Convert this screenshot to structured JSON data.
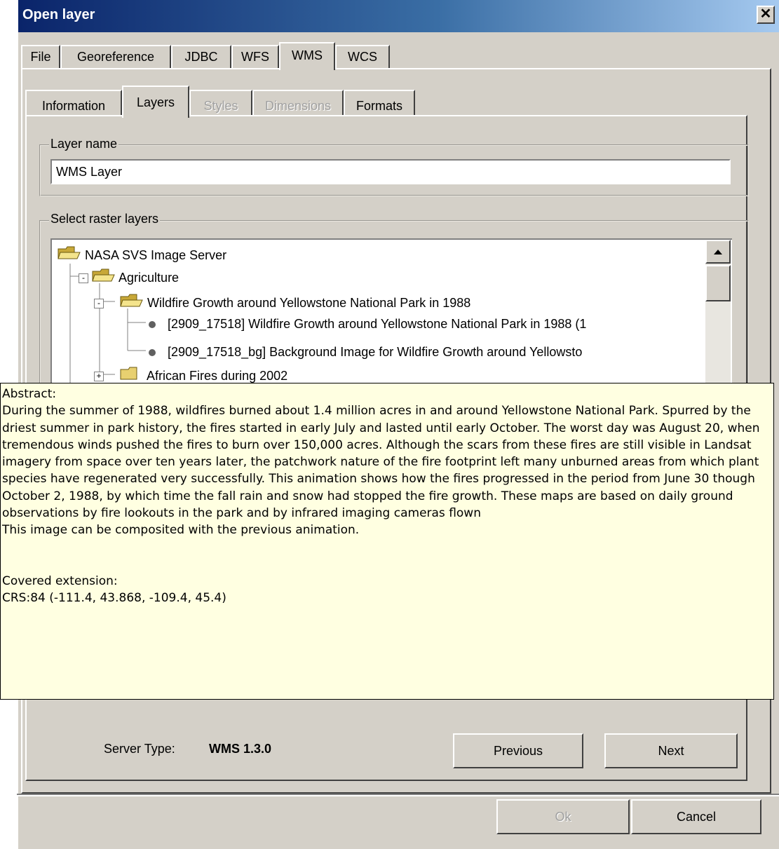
{
  "window": {
    "title": "Open layer",
    "close_label": "✕"
  },
  "tabs": [
    {
      "label": "File"
    },
    {
      "label": "Georeference"
    },
    {
      "label": "JDBC"
    },
    {
      "label": "WFS"
    },
    {
      "label": "WMS",
      "active": true
    },
    {
      "label": "WCS"
    }
  ],
  "subtabs": [
    {
      "label": "Information"
    },
    {
      "label": "Layers",
      "active": true
    },
    {
      "label": "Styles",
      "disabled": true
    },
    {
      "label": "Dimensions",
      "disabled": true
    },
    {
      "label": "Formats"
    }
  ],
  "layer_name": {
    "legend": "Layer name",
    "value": "WMS Layer"
  },
  "raster_layers": {
    "legend": "Select raster layers",
    "tree": [
      {
        "label": "NASA SVS Image Server",
        "type": "folder"
      },
      {
        "label": "Agriculture",
        "type": "folder",
        "expander": "-"
      },
      {
        "label": "Wildfire Growth around Yellowstone National Park in 1988",
        "type": "folder",
        "expander": "-"
      },
      {
        "label": "[2909_17518] Wildfire Growth around Yellowstone National Park in 1988 (1",
        "type": "leaf"
      },
      {
        "label": "[2909_17518_bg] Background Image for Wildfire Growth around Yellowsto",
        "type": "leaf"
      },
      {
        "label": "African Fires during 2002",
        "type": "folder",
        "expander": "+"
      }
    ]
  },
  "tooltip": {
    "abstract_label": "Abstract:",
    "abstract_text": "During the summer of 1988, wildfires burned about 1.4 million acres in and around Yellowstone National Park. Spurred by the driest summer in park history, the fires started in early July and lasted until early October. The worst day was August 20, when tremendous winds pushed the fires to burn over 150,000 acres. Although the scars from these fires are still visible in Landsat imagery from space over ten years later, the patchwork nature of the fire footprint left many unburned areas from which plant species have regenerated very successfully. This animation shows how the fires progressed in the period from June 30 though October 2, 1988, by which time the fall rain and snow had stopped the fire growth. These maps are based on daily ground observations by fire lookouts in the park and by infrared imaging cameras flown",
    "composite_note": "This image can be composited with the previous animation.",
    "extension_label": "Covered extension:",
    "extension_value": "CRS:84 (-111.4, 43.868, -109.4, 45.4)"
  },
  "server": {
    "label": "Server Type:",
    "value": "WMS 1.3.0"
  },
  "nav": {
    "previous": "Previous",
    "next": "Next"
  },
  "footer": {
    "ok": "Ok",
    "cancel": "Cancel"
  }
}
